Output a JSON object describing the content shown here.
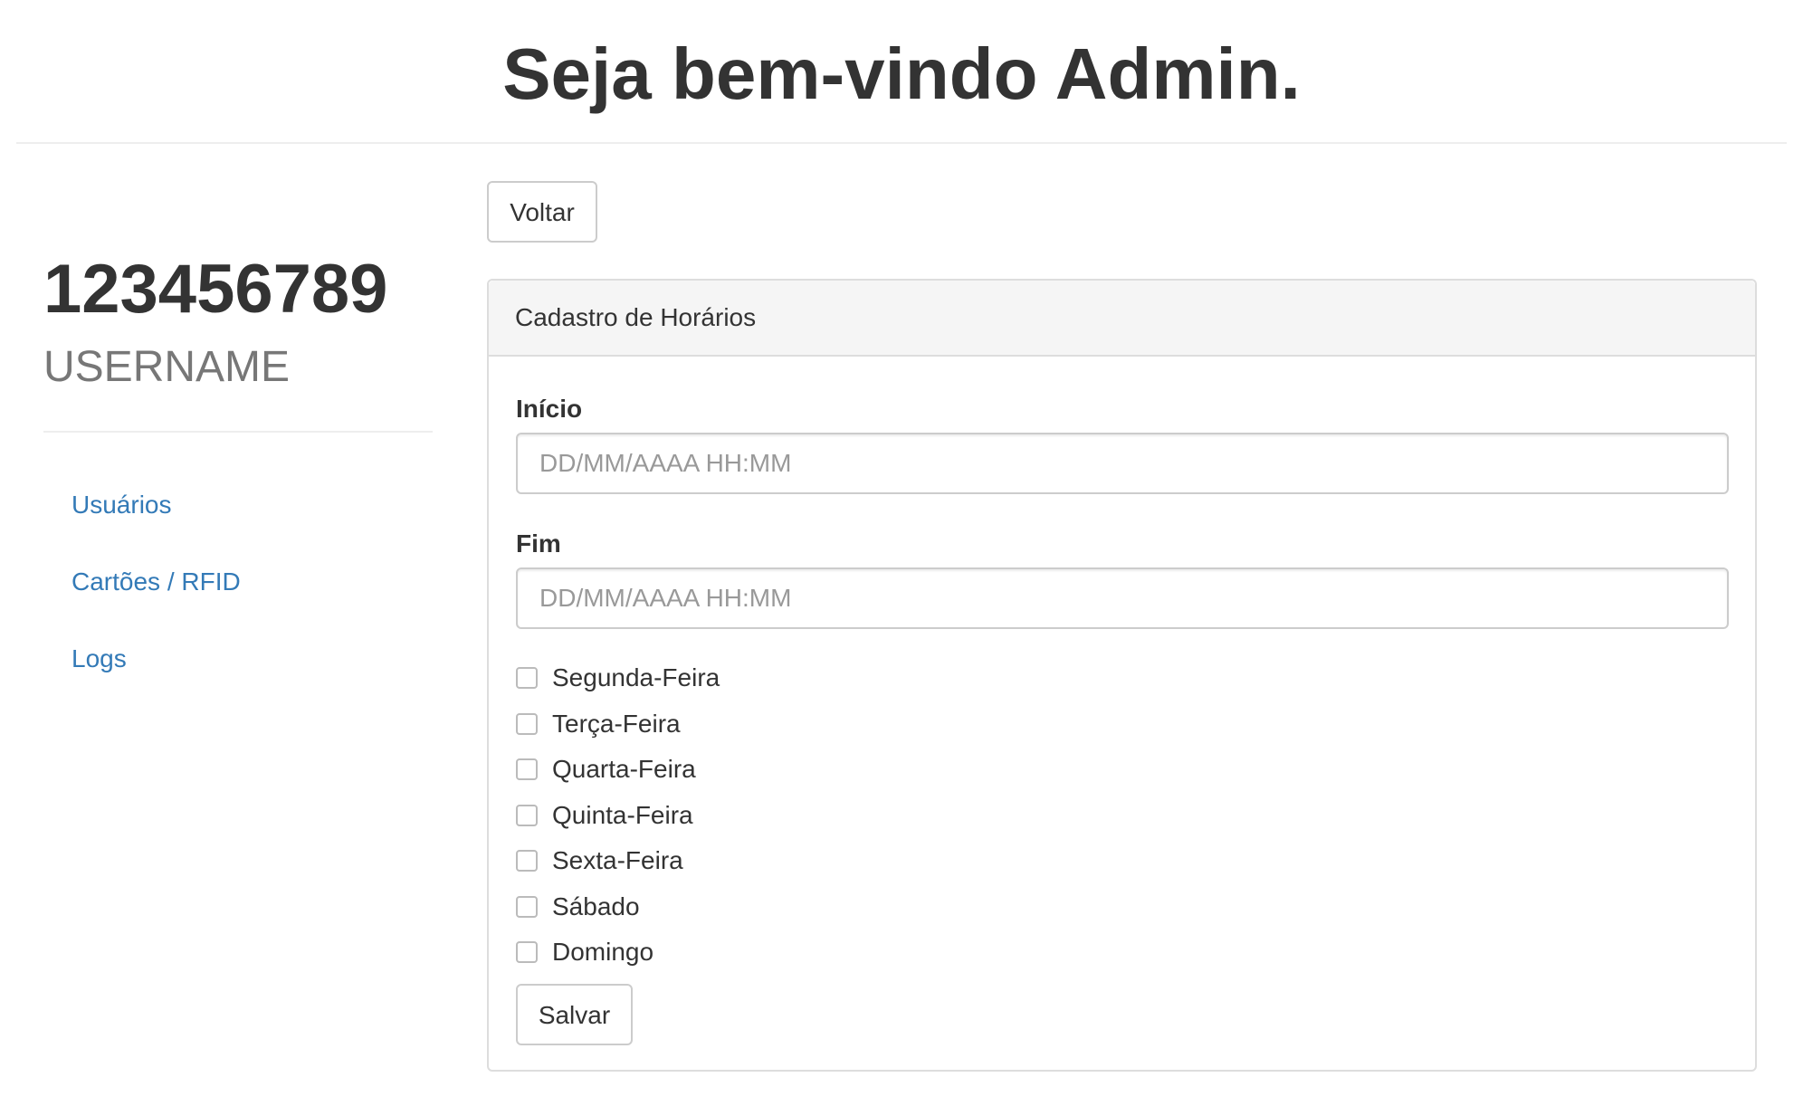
{
  "header": {
    "title": "Seja bem-vindo Admin."
  },
  "sidebar": {
    "user_id": "123456789",
    "username": "USERNAME",
    "items": [
      {
        "label": "Usuários"
      },
      {
        "label": "Cartões / RFID"
      },
      {
        "label": "Logs"
      }
    ],
    "link_color": "#337ab7"
  },
  "main": {
    "back_label": "Voltar",
    "panel": {
      "title": "Cadastro de Horários",
      "start": {
        "label": "Início",
        "value": "",
        "placeholder": "DD/MM/AAAA HH:MM"
      },
      "end": {
        "label": "Fim",
        "value": "",
        "placeholder": "DD/MM/AAAA HH:MM"
      },
      "days": [
        {
          "label": "Segunda-Feira",
          "checked": false
        },
        {
          "label": "Terça-Feira",
          "checked": false
        },
        {
          "label": "Quarta-Feira",
          "checked": false
        },
        {
          "label": "Quinta-Feira",
          "checked": false
        },
        {
          "label": "Sexta-Feira",
          "checked": false
        },
        {
          "label": "Sábado",
          "checked": false
        },
        {
          "label": "Domingo",
          "checked": false
        }
      ],
      "save_label": "Salvar"
    }
  }
}
